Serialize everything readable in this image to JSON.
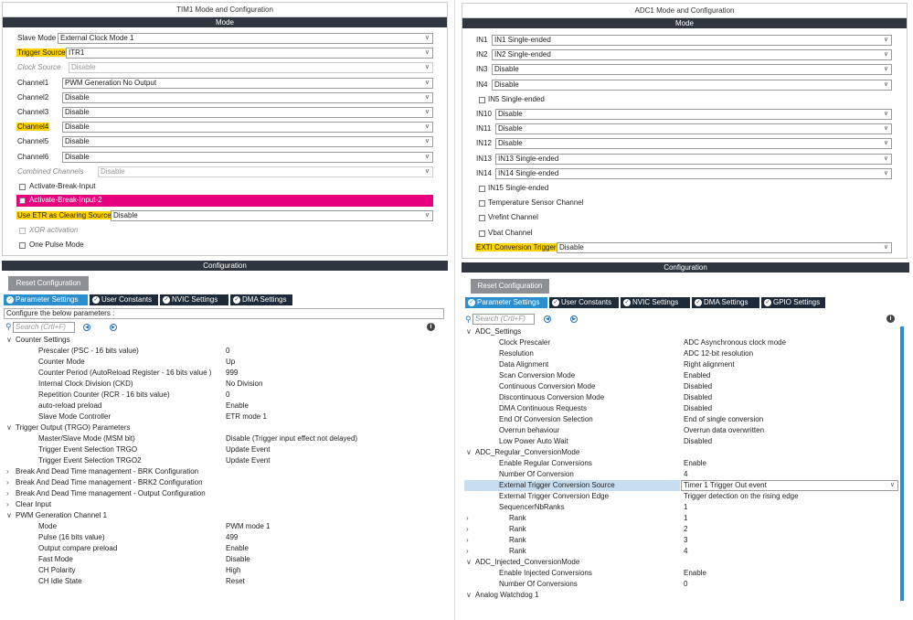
{
  "tim1": {
    "title": "TIM1 Mode and Configuration",
    "mode_header": "Mode",
    "fields": [
      {
        "label": "Slave Mode",
        "value": "External Clock Mode 1",
        "hl": false,
        "dis": false
      },
      {
        "label": "Trigger Source",
        "value": "ITR1",
        "hl": true,
        "dis": false
      },
      {
        "label": "Clock Source",
        "value": "Disable",
        "hl": false,
        "dis": true
      },
      {
        "label": "Channel1",
        "value": "PWM Generation No Output",
        "hl": false,
        "dis": false
      },
      {
        "label": "Channel2",
        "value": "Disable",
        "hl": false,
        "dis": false
      },
      {
        "label": "Channel3",
        "value": "Disable",
        "hl": false,
        "dis": false
      },
      {
        "label": "Channel4",
        "value": "Disable",
        "hl": true,
        "dis": false
      },
      {
        "label": "Channel5",
        "value": "Disable",
        "hl": false,
        "dis": false
      },
      {
        "label": "Channel6",
        "value": "Disable",
        "hl": false,
        "dis": false
      },
      {
        "label": "Combined Channels",
        "value": "Disable",
        "hl": false,
        "dis": true
      }
    ],
    "break1": "Activate-Break-Input",
    "break2": "Activate-Break-Input-2",
    "etr_label": "Use ETR as Clearing Source",
    "etr_value": "Disable",
    "xor": "XOR activation",
    "one_pulse": "One Pulse Mode",
    "config_header": "Configuration",
    "reset": "Reset Configuration",
    "tabs": [
      "Parameter Settings",
      "User Constants",
      "NVIC Settings",
      "DMA Settings"
    ],
    "configure_text": "Configure the below parameters :",
    "search_placeholder": "Search (Crtl+F)",
    "tree": [
      {
        "t": "group",
        "open": true,
        "label": "Counter Settings"
      },
      {
        "t": "item",
        "label": "Prescaler (PSC - 16 bits value)",
        "value": "0"
      },
      {
        "t": "item",
        "label": "Counter Mode",
        "value": "Up"
      },
      {
        "t": "item",
        "label": "Counter Period (AutoReload Register - 16 bits value )",
        "value": "999"
      },
      {
        "t": "item",
        "label": "Internal Clock Division (CKD)",
        "value": "No Division"
      },
      {
        "t": "item",
        "label": "Repetition Counter (RCR - 16 bits value)",
        "value": "0"
      },
      {
        "t": "item",
        "label": "auto-reload preload",
        "value": "Enable"
      },
      {
        "t": "item",
        "label": "Slave Mode Controller",
        "value": "ETR mode 1"
      },
      {
        "t": "group",
        "open": true,
        "label": "Trigger Output (TRGO) Parameters"
      },
      {
        "t": "item",
        "label": "Master/Slave Mode (MSM bit)",
        "value": "Disable (Trigger input effect not delayed)"
      },
      {
        "t": "item",
        "label": "Trigger Event Selection TRGO",
        "value": "Update Event"
      },
      {
        "t": "item",
        "label": "Trigger Event Selection TRGO2",
        "value": "Update Event"
      },
      {
        "t": "group",
        "open": false,
        "label": "Break And Dead Time management - BRK Configuration"
      },
      {
        "t": "group",
        "open": false,
        "label": "Break And Dead Time management - BRK2 Configuration"
      },
      {
        "t": "group",
        "open": false,
        "label": "Break And Dead Time management - Output Configuration"
      },
      {
        "t": "group",
        "open": false,
        "label": "Clear Input"
      },
      {
        "t": "group",
        "open": true,
        "label": "PWM Generation Channel 1"
      },
      {
        "t": "item",
        "label": "Mode",
        "value": "PWM mode 1"
      },
      {
        "t": "item",
        "label": "Pulse (16 bits value)",
        "value": "499"
      },
      {
        "t": "item",
        "label": "Output compare preload",
        "value": "Enable"
      },
      {
        "t": "item",
        "label": "Fast Mode",
        "value": "Disable"
      },
      {
        "t": "item",
        "label": "CH Polarity",
        "value": "High"
      },
      {
        "t": "item",
        "label": "CH Idle State",
        "value": "Reset"
      }
    ]
  },
  "adc1": {
    "title": "ADC1 Mode and Configuration",
    "mode_header": "Mode",
    "items": [
      {
        "t": "sel",
        "label": "IN1",
        "value": "IN1 Single-ended",
        "hl": false
      },
      {
        "t": "sel",
        "label": "IN2",
        "value": "IN2 Single-ended",
        "hl": false
      },
      {
        "t": "sel",
        "label": "IN3",
        "value": "Disable",
        "hl": false
      },
      {
        "t": "sel",
        "label": "IN4",
        "value": "Disable",
        "hl": false
      },
      {
        "t": "cb",
        "label": "IN5 Single-ended"
      },
      {
        "t": "sel",
        "label": "IN10",
        "value": "Disable",
        "hl": false
      },
      {
        "t": "sel",
        "label": "IN11",
        "value": "Disable",
        "hl": false
      },
      {
        "t": "sel",
        "label": "IN12",
        "value": "Disable",
        "hl": false
      },
      {
        "t": "sel",
        "label": "IN13",
        "value": "IN13 Single-ended",
        "hl": false
      },
      {
        "t": "sel",
        "label": "IN14",
        "value": "IN14 Single-ended",
        "hl": false
      },
      {
        "t": "cb",
        "label": "IN15 Single-ended"
      },
      {
        "t": "cb",
        "label": "Temperature Sensor Channel"
      },
      {
        "t": "cb",
        "label": "Vrefint Channel"
      },
      {
        "t": "cb",
        "label": "Vbat Channel"
      },
      {
        "t": "sel",
        "label": "EXTI Conversion Trigger",
        "value": "Disable",
        "hl": true
      }
    ],
    "config_header": "Configuration",
    "reset": "Reset Configuration",
    "tabs": [
      "Parameter Settings",
      "User Constants",
      "NVIC Settings",
      "DMA Settings",
      "GPIO Settings"
    ],
    "search_placeholder": "Search (Crtl+F)",
    "tree": [
      {
        "t": "group",
        "open": true,
        "label": "ADC_Settings"
      },
      {
        "t": "item",
        "label": "Clock Prescaler",
        "value": "ADC Asynchronous clock mode"
      },
      {
        "t": "item",
        "label": "Resolution",
        "value": "ADC 12-bit resolution"
      },
      {
        "t": "item",
        "label": "Data Alignment",
        "value": "Right alignment"
      },
      {
        "t": "item",
        "label": "Scan Conversion Mode",
        "value": "Enabled"
      },
      {
        "t": "item",
        "label": "Continuous Conversion Mode",
        "value": "Disabled"
      },
      {
        "t": "item",
        "label": "Discontinuous Conversion Mode",
        "value": "Disabled"
      },
      {
        "t": "item",
        "label": "DMA Continuous Requests",
        "value": "Disabled"
      },
      {
        "t": "item",
        "label": "End Of Conversion Selection",
        "value": "End of single conversion"
      },
      {
        "t": "item",
        "label": "Overrun behaviour",
        "value": "Overrun data overwritten"
      },
      {
        "t": "item",
        "label": "Low Power Auto Wait",
        "value": "Disabled"
      },
      {
        "t": "group",
        "open": true,
        "label": "ADC_Regular_ConversionMode"
      },
      {
        "t": "item",
        "label": "Enable Regular Conversions",
        "value": "Enable"
      },
      {
        "t": "item",
        "label": "Number Of Conversion",
        "value": "4"
      },
      {
        "t": "selitem",
        "label": "External Trigger Conversion Source",
        "value": "Timer 1 Trigger Out event"
      },
      {
        "t": "item",
        "label": "External Trigger Conversion Edge",
        "value": "Trigger detection on the rising edge"
      },
      {
        "t": "item",
        "label": "SequencerNbRanks",
        "value": "1"
      },
      {
        "t": "rank",
        "label": "Rank",
        "value": "1"
      },
      {
        "t": "rank",
        "label": "Rank",
        "value": "2"
      },
      {
        "t": "rank",
        "label": "Rank",
        "value": "3"
      },
      {
        "t": "rank",
        "label": "Rank",
        "value": "4"
      },
      {
        "t": "group",
        "open": true,
        "label": "ADC_Injected_ConversionMode"
      },
      {
        "t": "item",
        "label": "Enable Injected Conversions",
        "value": "Enable"
      },
      {
        "t": "item",
        "label": "Number Of Conversions",
        "value": "0"
      },
      {
        "t": "group",
        "open": true,
        "label": "Analog Watchdog 1"
      }
    ]
  }
}
